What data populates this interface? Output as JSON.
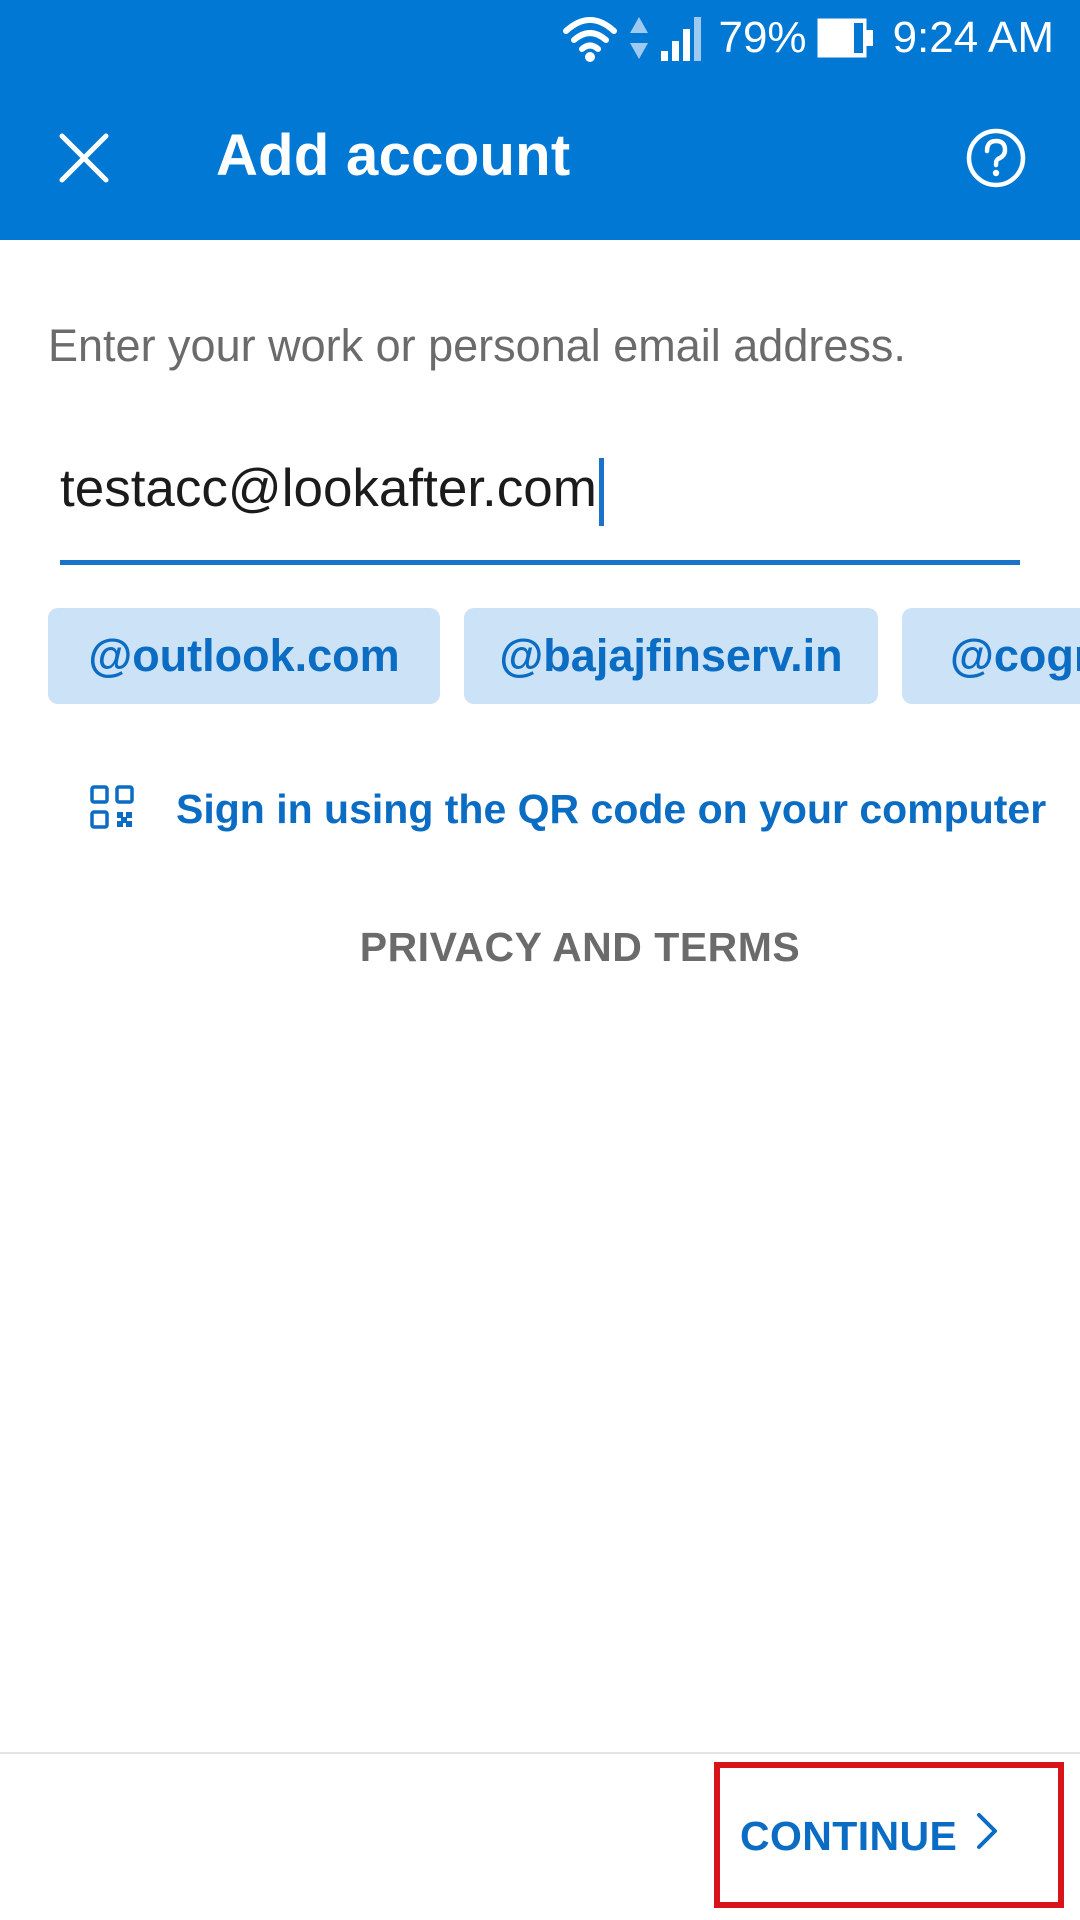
{
  "status_bar": {
    "battery_percent": "79%",
    "time": "9:24 AM",
    "icons": [
      "wifi-icon",
      "data-arrows-icon",
      "signal-icon",
      "battery-icon"
    ]
  },
  "app_bar": {
    "title": "Add account",
    "close_icon": "close-icon",
    "help_icon": "help-icon"
  },
  "form": {
    "prompt": "Enter your work or personal email address.",
    "email_value": "testacc@lookafter.com"
  },
  "domain_suggestions": [
    "@outlook.com",
    "@bajajfinserv.in",
    "@cogr"
  ],
  "qr_signin": {
    "icon": "qr-code-icon",
    "label": "Sign in using the QR code on your computer"
  },
  "privacy_link": "PRIVACY AND TERMS",
  "footer": {
    "continue_label": "CONTINUE",
    "continue_icon": "chevron-right-icon"
  },
  "colors": {
    "brand_blue": "#0078D4",
    "link_blue": "#0B6CC3",
    "chip_bg": "#CCE2F6",
    "highlight_red": "#D9131A",
    "muted_text": "#6B6B6B"
  }
}
